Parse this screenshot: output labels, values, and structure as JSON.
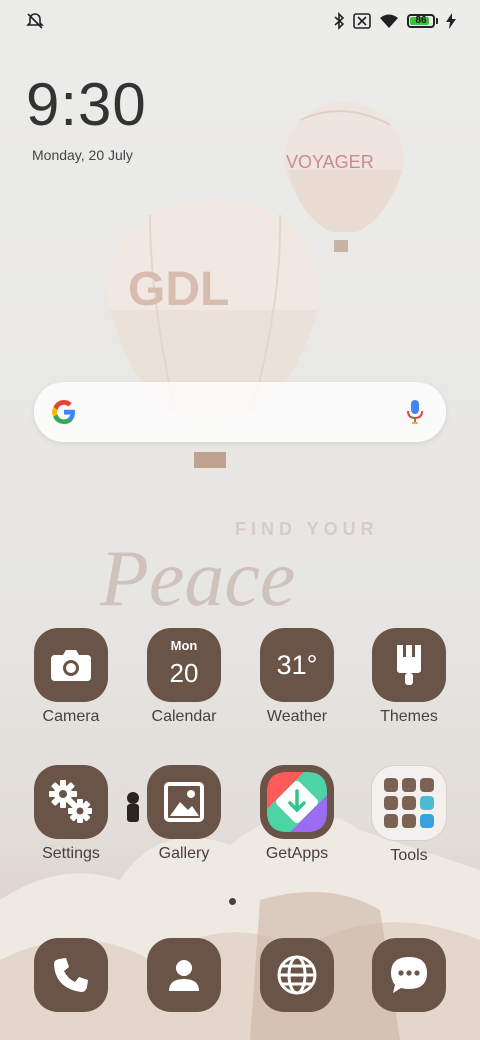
{
  "status": {
    "battery_level": "86",
    "battery_fraction": 0.86,
    "icons": [
      "mute-icon",
      "bluetooth-icon",
      "sim-blocked-icon",
      "wifi-icon",
      "battery-icon",
      "charging-icon"
    ]
  },
  "clock": {
    "time": "9:30",
    "date": "Monday, 20 July"
  },
  "wallpaper": {
    "balloon_left_text": "GDL",
    "balloon_right_text": "VOYAGER",
    "tagline": "FIND YOUR",
    "script": "Peace"
  },
  "search": {
    "provider": "Google"
  },
  "apps": [
    {
      "label": "Camera",
      "icon": "camera-icon"
    },
    {
      "label": "Calendar",
      "icon": "calendar-icon",
      "month": "Mon",
      "day": "20"
    },
    {
      "label": "Weather",
      "icon": "weather-icon",
      "temp": "31°"
    },
    {
      "label": "Themes",
      "icon": "paintbrush-icon"
    },
    {
      "label": "Settings",
      "icon": "gears-icon"
    },
    {
      "label": "Gallery",
      "icon": "image-icon"
    },
    {
      "label": "GetApps",
      "icon": "getapps-icon"
    },
    {
      "label": "Tools",
      "icon": "folder-icon"
    }
  ],
  "dock": [
    {
      "icon": "phone-icon"
    },
    {
      "icon": "contacts-icon"
    },
    {
      "icon": "browser-icon"
    },
    {
      "icon": "messages-icon"
    }
  ],
  "colors": {
    "icon_tile": "#6a5347",
    "accent_battery": "#3cc23c"
  }
}
